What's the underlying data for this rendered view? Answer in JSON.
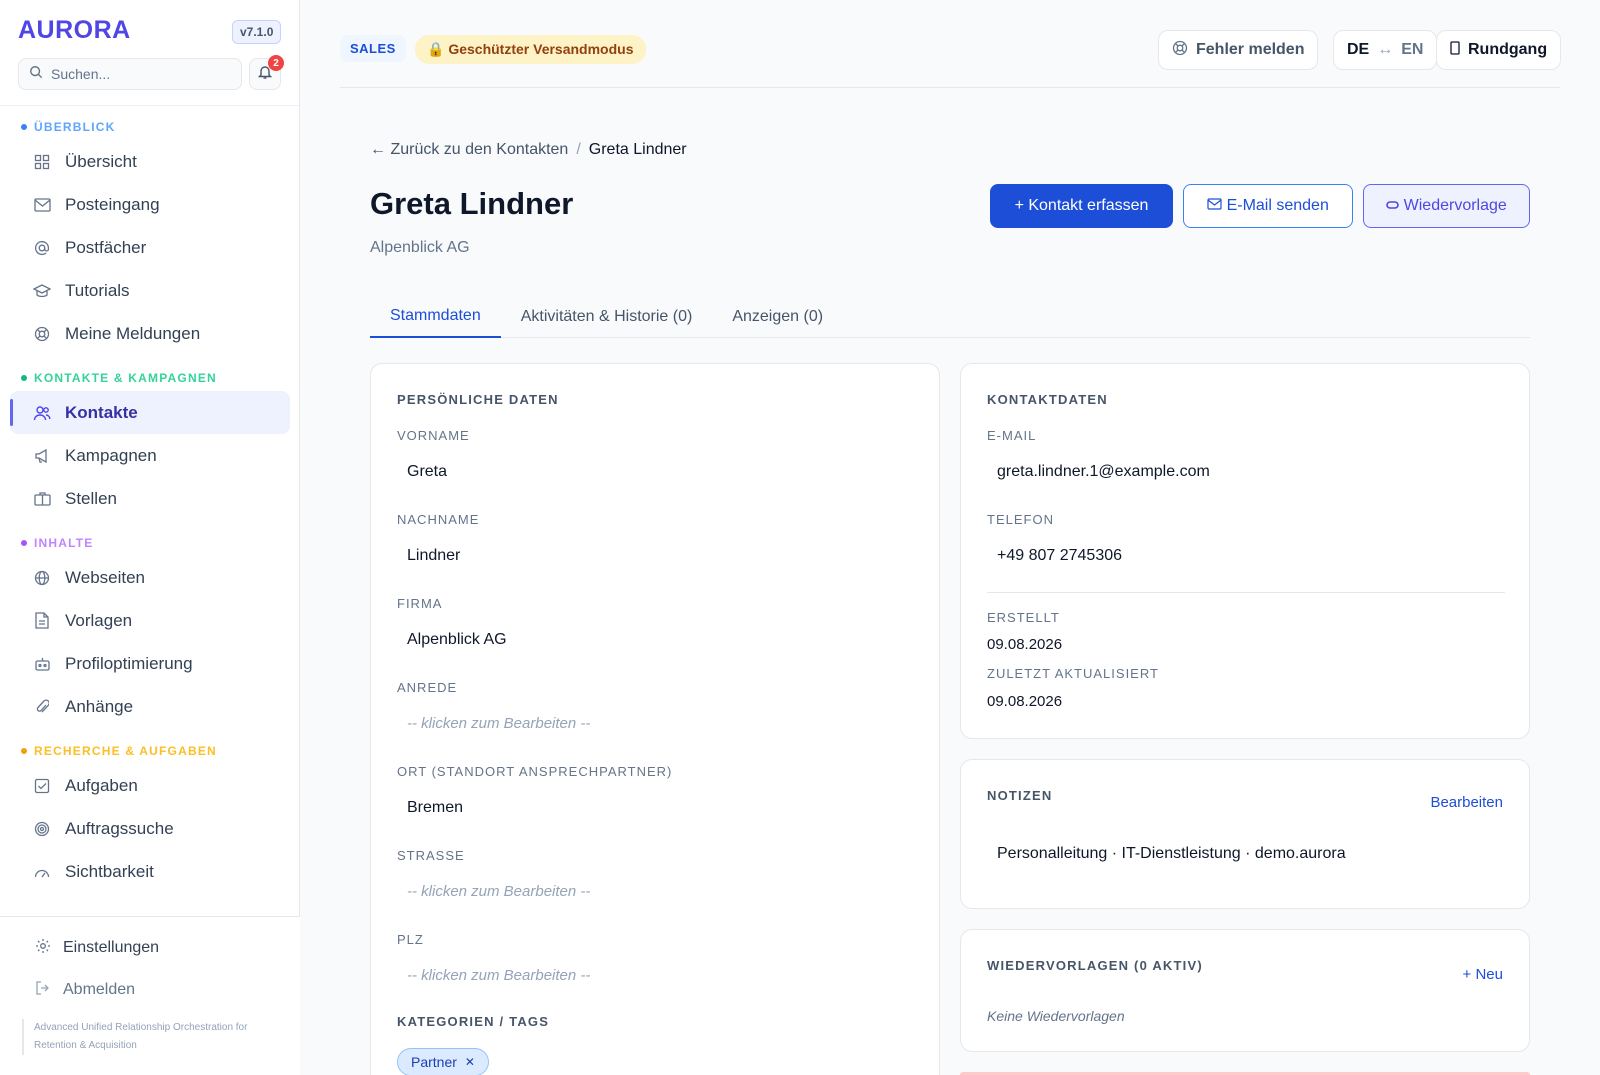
{
  "app": {
    "name": "AURORA",
    "version": "v7.1.0",
    "notifications": "2"
  },
  "search": {
    "placeholder": "Suchen..."
  },
  "sidebar": {
    "sections": [
      {
        "title": "ÜBERBLICK",
        "color": "#3b82f6",
        "items": [
          "Übersicht",
          "Posteingang",
          "Postfächer",
          "Tutorials",
          "Meine Meldungen"
        ]
      },
      {
        "title": "KONTAKTE & KAMPAGNEN",
        "color": "#10b981",
        "items": [
          "Kontakte",
          "Kampagnen",
          "Stellen"
        ]
      },
      {
        "title": "INHALTE",
        "color": "#a855f7",
        "items": [
          "Webseiten",
          "Vorlagen",
          "Profiloptimierung",
          "Anhänge"
        ]
      },
      {
        "title": "RECHERCHE & AUFGABEN",
        "color": "#f59e0b",
        "items": [
          "Aufgaben",
          "Auftragssuche",
          "Sichtbarkeit"
        ]
      }
    ],
    "settings": "Einstellungen",
    "logout": "Abmelden",
    "tagline": "Advanced Unified Relationship Orchestration for Retention & Acquisition"
  },
  "topbar": {
    "sales": "SALES",
    "mode": "Geschützter Versandmodus",
    "report": "Fehler melden",
    "lang_de": "DE",
    "lang_arrow": "↔",
    "lang_en": "EN",
    "tour": "Rundgang"
  },
  "breadcrumb": {
    "back": "← Zurück zu den Kontakten",
    "sep": "/",
    "current": "Greta Lindner"
  },
  "contact": {
    "name": "Greta Lindner",
    "company": "Alpenblick AG"
  },
  "actions": {
    "add": "+ Kontakt erfassen",
    "email": "E-Mail senden",
    "followup": "Wiedervorlage"
  },
  "tabs": [
    "Stammdaten",
    "Aktivitäten & Historie (0)",
    "Anzeigen (0)"
  ],
  "personal": {
    "title": "PERSÖNLICHE DATEN",
    "firstname_label": "VORNAME",
    "firstname": "Greta",
    "lastname_label": "NACHNAME",
    "lastname": "Lindner",
    "company_label": "FIRMA",
    "company": "Alpenblick AG",
    "salutation_label": "ANREDE",
    "salutation_placeholder": "-- klicken zum Bearbeiten --",
    "city_label": "ORT (STANDORT ANSPRECHPARTNER)",
    "city": "Bremen",
    "street_label": "STRASSE",
    "street_placeholder": "-- klicken zum Bearbeiten --",
    "zip_label": "PLZ",
    "zip_placeholder": "-- klicken zum Bearbeiten --",
    "tags_label": "KATEGORIEN / TAGS",
    "tag": "Partner"
  },
  "contactdata": {
    "title": "KONTAKTDATEN",
    "email_label": "E-MAIL",
    "email": "greta.lindner.1@example.com",
    "phone_label": "TELEFON",
    "phone": "+49 807 2745306",
    "created_label": "ERSTELLT",
    "created": "09.08.2026",
    "updated_label": "ZULETZT AKTUALISIERT",
    "updated": "09.08.2026"
  },
  "notes": {
    "title": "NOTIZEN",
    "edit": "Bearbeiten",
    "text": "Personalleitung · IT-Dienstleistung · demo.aurora"
  },
  "followups": {
    "title": "WIEDERVORLAGEN (0 AKTIV)",
    "new": "+ Neu",
    "empty": "Keine Wiedervorlagen"
  }
}
